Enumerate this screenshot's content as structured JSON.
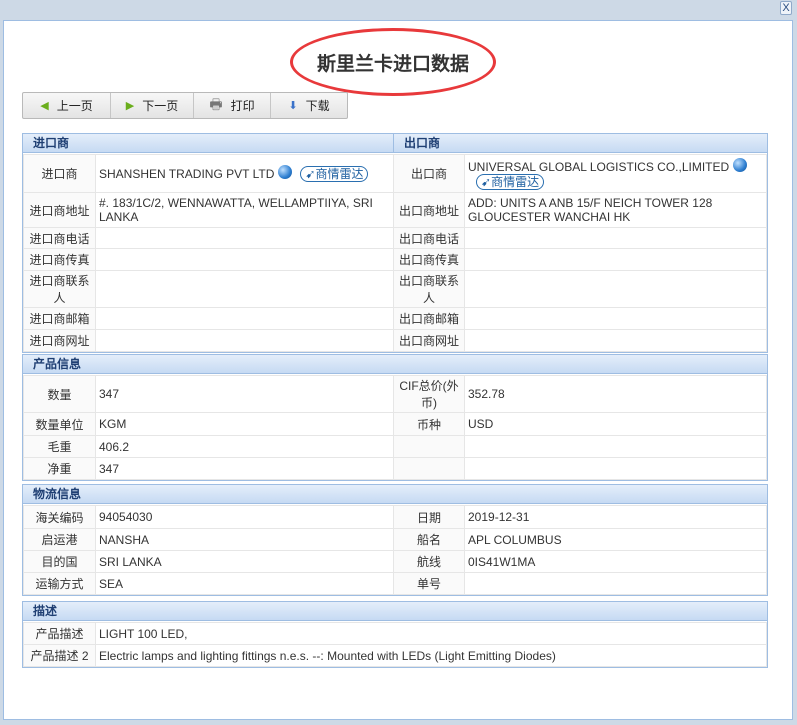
{
  "window": {
    "close_label": "X"
  },
  "title": "斯里兰卡进口数据",
  "toolbar": {
    "prev": "上一页",
    "next": "下一页",
    "print": "打印",
    "download": "下载"
  },
  "radar_label": "商情雷达",
  "parties": {
    "importer_header": "进口商",
    "exporter_header": "出口商",
    "rows": [
      {
        "il": "进口商",
        "iv": "SHANSHEN TRADING PVT LTD",
        "el": "出口商",
        "ev": "UNIVERSAL GLOBAL LOGISTICS CO.,LIMITED"
      },
      {
        "il": "进口商地址",
        "iv": "#. 183/1C/2, WENNAWATTA, WELLAMPTIIYA, SRI LANKA",
        "el": "出口商地址",
        "ev": "ADD: UNITS A ANB 15/F NEICH TOWER 128 GLOUCESTER WANCHAI HK"
      },
      {
        "il": "进口商电话",
        "iv": "",
        "el": "出口商电话",
        "ev": ""
      },
      {
        "il": "进口商传真",
        "iv": "",
        "el": "出口商传真",
        "ev": ""
      },
      {
        "il": "进口商联系人",
        "iv": "",
        "el": "出口商联系人",
        "ev": ""
      },
      {
        "il": "进口商邮箱",
        "iv": "",
        "el": "出口商邮箱",
        "ev": ""
      },
      {
        "il": "进口商网址",
        "iv": "",
        "el": "出口商网址",
        "ev": ""
      }
    ]
  },
  "product": {
    "header": "产品信息",
    "rows": [
      {
        "l1": "数量",
        "v1": "347",
        "l2": "CIF总价(外币)",
        "v2": "352.78"
      },
      {
        "l1": "数量单位",
        "v1": "KGM",
        "l2": "币种",
        "v2": "USD"
      },
      {
        "l1": "毛重",
        "v1": "406.2",
        "l2": "",
        "v2": ""
      },
      {
        "l1": "净重",
        "v1": "347",
        "l2": "",
        "v2": ""
      }
    ]
  },
  "logistics": {
    "header": "物流信息",
    "rows": [
      {
        "l1": "海关编码",
        "v1": "94054030",
        "l2": "日期",
        "v2": "2019-12-31"
      },
      {
        "l1": "启运港",
        "v1": "NANSHA",
        "l2": "船名",
        "v2": "APL COLUMBUS"
      },
      {
        "l1": "目的国",
        "v1": "SRI LANKA",
        "l2": "航线",
        "v2": "0IS41W1MA"
      },
      {
        "l1": "运输方式",
        "v1": "SEA",
        "l2": "单号",
        "v2": ""
      }
    ]
  },
  "description": {
    "header": "描述",
    "rows": [
      {
        "l": "产品描述",
        "v": "LIGHT 100 LED,"
      },
      {
        "l": "产品描述 2",
        "v": "Electric lamps and lighting fittings n.e.s. --: Mounted with LEDs (Light Emitting Diodes)"
      }
    ]
  }
}
